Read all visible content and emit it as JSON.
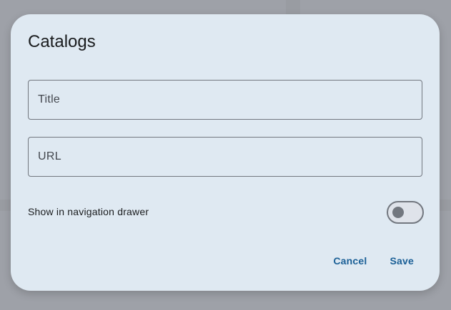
{
  "dialog": {
    "title": "Catalogs",
    "fields": {
      "title": {
        "placeholder": "Title",
        "value": ""
      },
      "url": {
        "placeholder": "URL",
        "value": ""
      }
    },
    "switch": {
      "label": "Show in navigation drawer",
      "checked": false
    },
    "actions": {
      "cancel_label": "Cancel",
      "save_label": "Save"
    }
  },
  "colors": {
    "dialog_background": "#dfe9f2",
    "accent": "#1a5f96",
    "outline": "#72777f",
    "scrim": "#9fa3a9"
  }
}
